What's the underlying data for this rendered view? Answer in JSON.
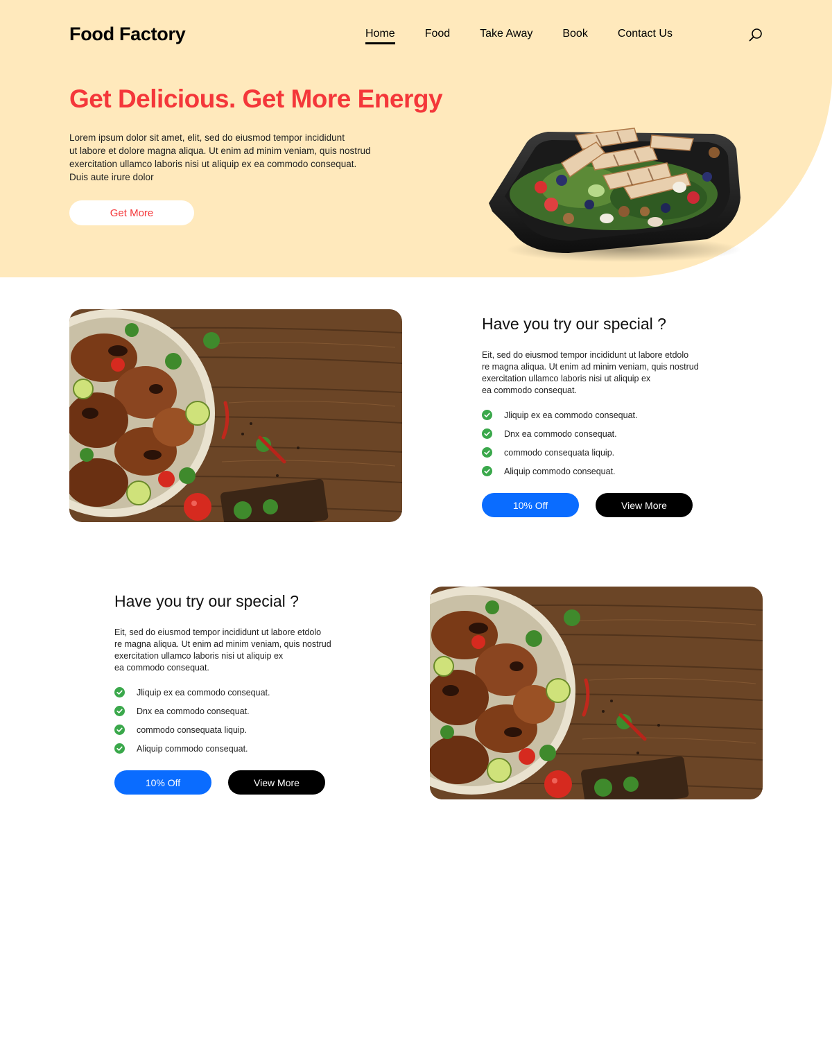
{
  "header": {
    "logo": "Food Factory",
    "nav": [
      {
        "label": "Home",
        "active": true
      },
      {
        "label": "Food",
        "active": false
      },
      {
        "label": "Take Away",
        "active": false
      },
      {
        "label": "Book",
        "active": false
      },
      {
        "label": "Contact Us",
        "active": false
      }
    ],
    "search_icon": "search-icon"
  },
  "hero": {
    "title": "Get Delicious. Get More Energy",
    "description_lines": [
      "Lorem ipsum dolor sit amet,  elit, sed do eiusmod tempor incididunt",
      "ut labore et dolore magna aliqua. Ut enim ad minim veniam, quis nostrud",
      "exercitation ullamco laboris nisi ut aliquip ex ea commodo consequat.",
      "Duis aute irure dolor"
    ],
    "button": "Get More"
  },
  "specials": [
    {
      "title": "Have you try our special ?",
      "description_lines": [
        "Eit, sed do eiusmod tempor incididunt ut labore etdolo",
        "re magna aliqua. Ut enim ad minim veniam, quis nostrud",
        "exercitation ullamco laboris nisi ut aliquip ex",
        "ea commodo consequat."
      ],
      "features": [
        "Jliquip ex ea commodo consequat.",
        "Dnx ea commodo consequat.",
        "commodo consequata liquip.",
        "Aliquip commodo consequat."
      ],
      "discount_button": "10% Off",
      "view_button": "View More"
    },
    {
      "title": "Have you try our special ?",
      "description_lines": [
        "Eit, sed do eiusmod tempor incididunt ut labore etdolo",
        "re magna aliqua. Ut enim ad minim veniam, quis nostrud",
        "exercitation ullamco laboris nisi ut aliquip ex",
        "ea commodo consequat."
      ],
      "features": [
        "Jliquip ex ea commodo consequat.",
        "Dnx ea commodo consequat.",
        "commodo consequata liquip.",
        "Aliquip commodo consequat."
      ],
      "discount_button": "10% Off",
      "view_button": "View More"
    }
  ],
  "colors": {
    "hero_bg": "#ffe9bc",
    "accent_red": "#f4373a",
    "button_blue": "#0a6cff",
    "check_green": "#3aa84b"
  }
}
